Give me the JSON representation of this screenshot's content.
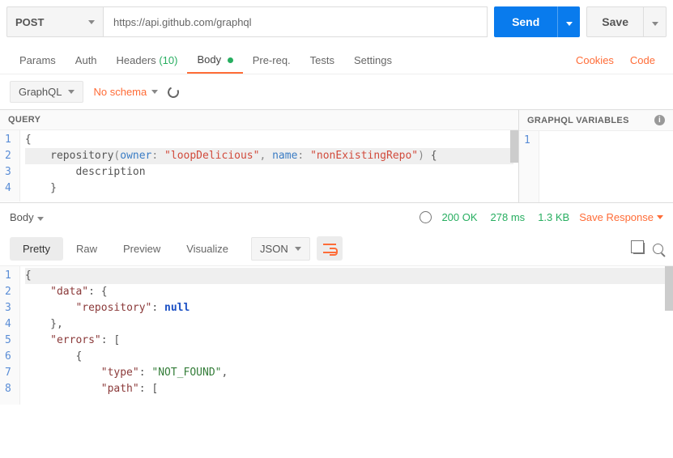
{
  "request": {
    "method": "POST",
    "url": "https://api.github.com/graphql",
    "send_label": "Send",
    "save_label": "Save"
  },
  "tabs": {
    "params": "Params",
    "auth": "Auth",
    "headers": "Headers",
    "headers_count": "(10)",
    "body": "Body",
    "prereq": "Pre-req.",
    "tests": "Tests",
    "settings": "Settings",
    "cookies": "Cookies",
    "code": "Code"
  },
  "body_settings": {
    "type": "GraphQL",
    "schema": "No schema"
  },
  "panes": {
    "query_title": "QUERY",
    "vars_title": "GRAPHQL VARIABLES"
  },
  "query_lines": [
    "1",
    "2",
    "3",
    "4"
  ],
  "query_code": {
    "l1": "{",
    "l2_fn": "repository",
    "l2_arg1": "owner",
    "l2_val1": "\"loopDelicious\"",
    "l2_arg2": "name",
    "l2_val2": "\"nonExistingRepo\"",
    "l3": "description",
    "l4": "}"
  },
  "vars_lines": [
    "1"
  ],
  "response": {
    "body_label": "Body",
    "status": "200 OK",
    "time": "278 ms",
    "size": "1.3 KB",
    "save_label": "Save Response"
  },
  "resp_tabs": {
    "pretty": "Pretty",
    "raw": "Raw",
    "preview": "Preview",
    "visualize": "Visualize",
    "format": "JSON"
  },
  "resp_lines": [
    "1",
    "2",
    "3",
    "4",
    "5",
    "6",
    "7",
    "8"
  ],
  "resp_code": {
    "l1": "{",
    "l2_k": "\"data\"",
    "l3_k": "\"repository\"",
    "l3_v": "null",
    "l5_k": "\"errors\"",
    "l7_k": "\"type\"",
    "l7_v": "\"NOT_FOUND\"",
    "l8_k": "\"path\""
  }
}
